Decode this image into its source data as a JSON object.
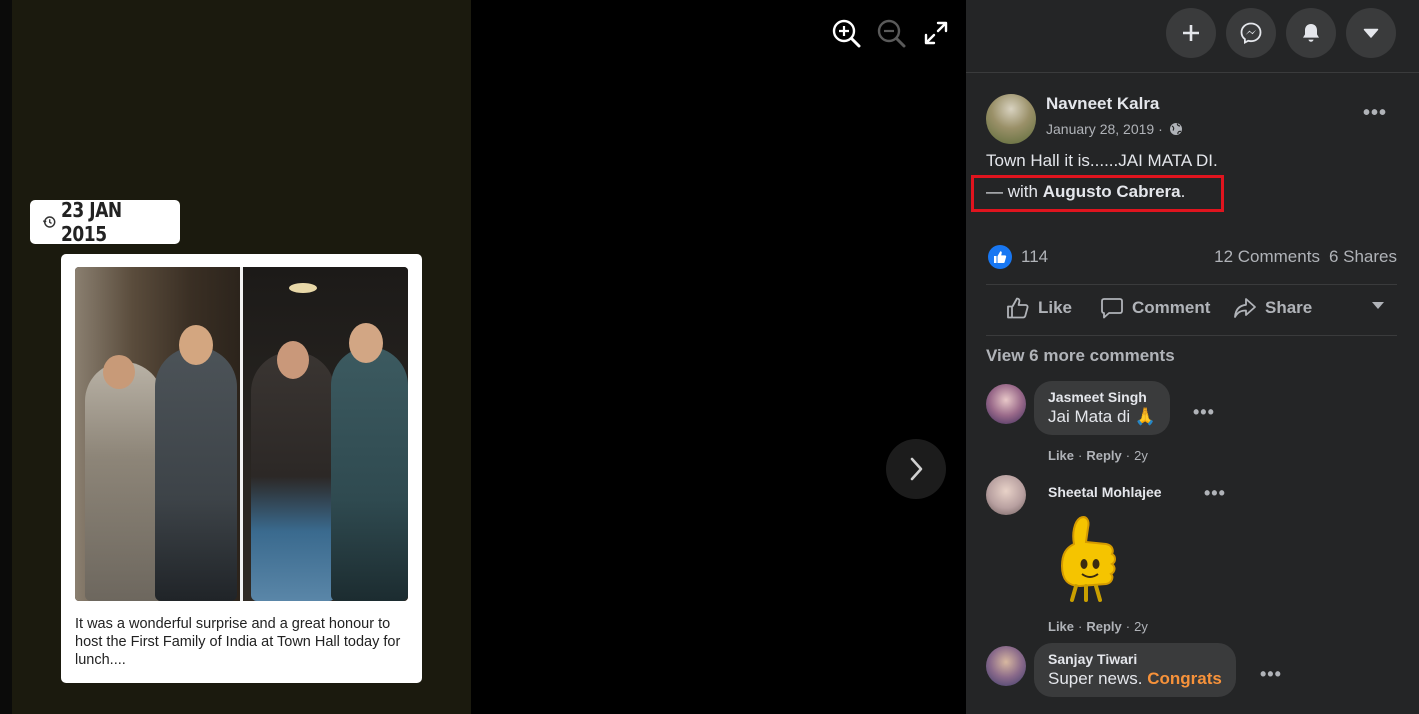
{
  "viewer": {
    "date_badge": "23 JAN 2015",
    "caption": "It was a wonderful surprise and a great honour to host the First Family of India at Town Hall today for lunch....",
    "icons": [
      "zoom-in-icon",
      "zoom-out-icon",
      "fullscreen-icon",
      "chevron-right-icon"
    ]
  },
  "topbar": {
    "buttons": [
      "plus-icon",
      "messenger-icon",
      "bell-icon",
      "caret-down-icon"
    ]
  },
  "post": {
    "author": "Navneet Kalra",
    "date": "January 28, 2019 ·",
    "text": "Town Hall it is......JAI MATA DI.",
    "with_prefix": "— with ",
    "with_name": "Augusto Cabrera",
    "with_suffix": ".",
    "reactions_count": "114",
    "comments_count": "12 Comments",
    "shares_count": "6 Shares",
    "actions": {
      "like": "Like",
      "comment": "Comment",
      "share": "Share"
    },
    "view_more": "View 6 more comments"
  },
  "comments": [
    {
      "name": "Jasmeet Singh",
      "text": "Jai Mata di 🙏",
      "like": "Like",
      "reply": "Reply",
      "sep": "·",
      "age": "2y"
    },
    {
      "name": "Sheetal Mohlajee",
      "sticker": "thumbs-up sticker",
      "like": "Like",
      "reply": "Reply",
      "sep": "·",
      "age": "2y"
    },
    {
      "name": "Sanjay Tiwari",
      "text_plain": "Super news. ",
      "text_highlight": "Congrats"
    }
  ],
  "colors": {
    "panel_bg": "#242526",
    "bubble_bg": "#3a3b3c",
    "highlight_box": "#e0141e",
    "like_blue": "#1877f2",
    "congrats_orange": "#f7923a"
  }
}
